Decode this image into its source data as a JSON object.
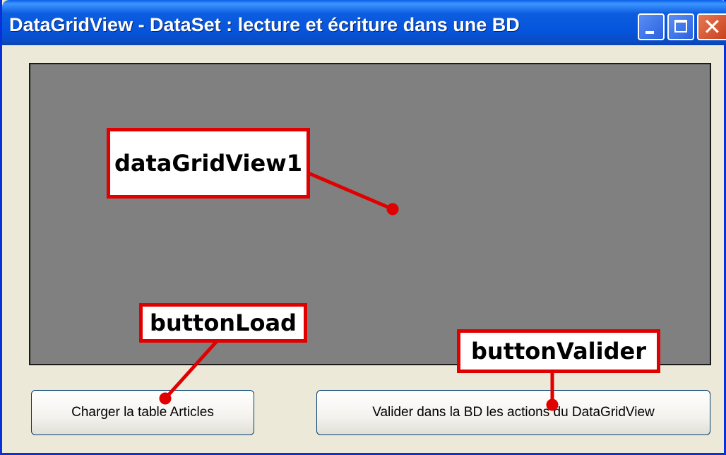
{
  "window": {
    "title": "DataGridView - DataSet : lecture et écriture dans une BD",
    "controls": [
      "minimize-icon",
      "maximize-icon",
      "close-icon"
    ]
  },
  "buttons": {
    "load_label": "Charger la table Articles",
    "valider_label": "Valider dans la BD les actions du DataGridView"
  },
  "callouts": {
    "grid": "dataGridView1",
    "load": "buttonLoad",
    "valider": "buttonValider"
  },
  "colors": {
    "callout_border": "#E00000",
    "grid_background": "#808080",
    "titlebar": "#0554DB"
  }
}
